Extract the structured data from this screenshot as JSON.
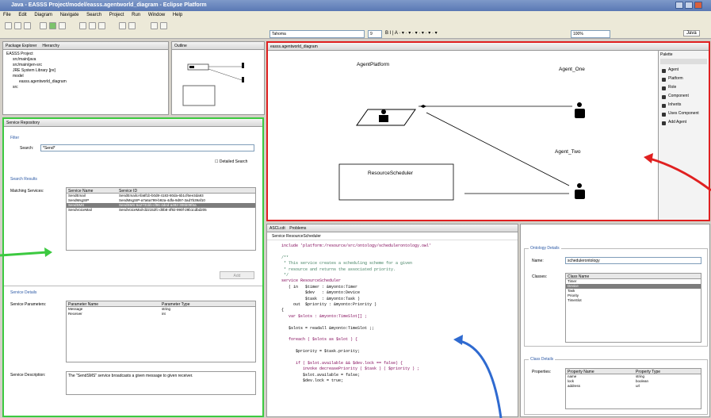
{
  "window": {
    "title": "Java - EASSS Project/model/easss.agentworld_diagram - Eclipse Platform"
  },
  "menu": [
    "File",
    "Edit",
    "Diagram",
    "Navigate",
    "Search",
    "Project",
    "Run",
    "Window",
    "Help"
  ],
  "toolbar": {
    "font": "Tahoma",
    "size": "9",
    "zoom": "100%",
    "perspective": "Java"
  },
  "package_explorer": {
    "tab": "Package Explorer",
    "tab2": "Hierarchy",
    "outline_tab": "Outline",
    "items": [
      "EASSS Project",
      "src/main/java",
      "src/main/gen-src",
      "JRE System Library [jre]",
      "model",
      "easss.agentworld_diagram",
      "src"
    ]
  },
  "diagram": {
    "tab": "easss.agentworld_diagram",
    "platform": "AgentPlatform",
    "agent_one": "Agent_One",
    "agent_two": "Agent_Two",
    "resource": "ResourceScheduler"
  },
  "palette": {
    "title": "Palette",
    "items": [
      "Agent",
      "Platform",
      "Role",
      "Component",
      "Inherits",
      "Uses Component",
      "Add Agent"
    ]
  },
  "service_repository": {
    "tab": "Service Repository",
    "filter_section": "Filter",
    "search_label": "Search:",
    "search_value": "*Send*",
    "detailed_search": "Detailed Search",
    "results_section": "Search Results",
    "matching_label": "Matching Services:",
    "col_name": "Service Name",
    "col_id": "Service ID",
    "rows": [
      [
        "SendEmail",
        "SendEmailcAfa6f1b-b0d8-4183-80da-6b1cf6ee3da93"
      ],
      [
        "SendMsgSIP",
        "SendMsgSIP-a7a6a799-b92a-4dfa-9d97-3ad7b39af10"
      ],
      [
        "SendSMS",
        "SendSMS-6a2731bb-cf96-4ded-a492-306b09f4a"
      ],
      [
        "SendVoiceMail",
        "SendVoiceMail-d22152fc-d0b8-4f92-990f-29b1cdbd205"
      ]
    ],
    "add_button": "Add",
    "details_section": "Service Details",
    "params_label": "Service Parameters:",
    "col_param": "Parameter Name",
    "col_type": "Parameter Type",
    "params": [
      [
        "Message",
        "string"
      ],
      [
        "Receiver",
        "int"
      ]
    ],
    "desc_label": "Service Description:",
    "description": "The \"SendSMS\" service broadcasts a given message to given receiver."
  },
  "editor": {
    "tab": "ASCLcdt",
    "tab2": "Problems",
    "header": "Service ResourceScheduler"
  },
  "code": [
    "include 'platform:/resource/src/ontology/schedulerontology.owl'",
    "",
    "/**",
    " * This service creates a scheduling scheme for a given",
    " * resource and returns the associated priority.",
    " */",
    "service ResourceScheduler",
    "   ( in   $timer : &myonto:Timer",
    "          $dev   : &myonto:Device",
    "          $task  : &myonto:Task )",
    "     out  $priority : &myonto:Priority )",
    "{",
    "   var $slots : &myonto:TimeSlot[] ;",
    "",
    "   $slots = readall &myonto:TimeSlot ;;",
    "",
    "   foreach ( $slots as $slot ) {",
    "",
    "      $priority = $task.priority;",
    "",
    "      if ( $slot.available && $dev.lock == false) {",
    "         invoke decreasePriority ( $task ) ( $priority ) ;",
    "         $slot.available = false;",
    "         $dev.lock = true;"
  ],
  "ontology": {
    "section": "Ontology Details",
    "name_label": "Name:",
    "name_value": "schedulerontology",
    "classes_label": "Classes:",
    "col": "Class Name",
    "classes": [
      "Timer",
      "Device",
      "Task",
      "Priority",
      "TimeSlot"
    ],
    "class_section": "Class Details",
    "props_label": "Properties:",
    "col_prop": "Property Name",
    "col_ptype": "Property Type",
    "props": [
      [
        "name",
        "string"
      ],
      [
        "lock",
        "boolean"
      ],
      [
        "address",
        "url"
      ]
    ]
  }
}
